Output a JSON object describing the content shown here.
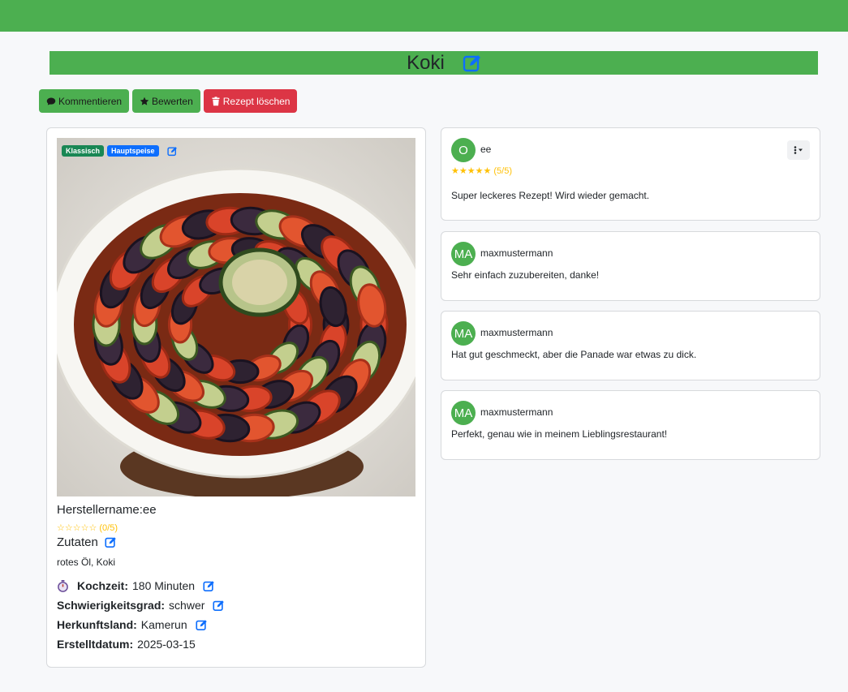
{
  "recipe": {
    "title": "Koki",
    "tags": [
      "Klassisch",
      "Hauptspeise"
    ],
    "maker": "Herstellername:ee",
    "rating": "☆☆☆☆☆ (0/5)",
    "ingredients_heading": "Zutaten",
    "ingredients": "rotes Öl, Koki",
    "info": {
      "cook_time_label": "Kochzeit:",
      "cook_time_value": "180 Minuten",
      "difficulty_label": "Schwierigkeitsgrad:",
      "difficulty_value": "schwer",
      "origin_label": "Herkunftsland:",
      "origin_value": "Kamerun",
      "created_label": "Erstelltdatum:",
      "created_value": "2025-03-15"
    }
  },
  "actions": {
    "comment_label": "Kommentieren",
    "rate_label": "Bewerten",
    "delete_label": "Rezept löschen"
  },
  "comments": [
    {
      "initials": "O",
      "user": "ee",
      "stars": "★★★★★ (5/5)",
      "text": "Super leckeres Rezept! Wird wieder gemacht."
    },
    {
      "initials": "MA",
      "user": "maxmustermann",
      "text": "Sehr einfach zuzubereiten, danke!"
    },
    {
      "initials": "MA",
      "user": "maxmustermann",
      "text": "Hat gut geschmeckt, aber die Panade war etwas zu dick."
    },
    {
      "initials": "MA",
      "user": "maxmustermann",
      "text": "Perfekt, genau wie in meinem Lieblingsrestaurant!"
    }
  ],
  "colors": {
    "brand_green": "#4caf50",
    "danger_red": "#dc3545",
    "edit_blue": "#0d6efd",
    "star_yellow": "#ffc107"
  }
}
